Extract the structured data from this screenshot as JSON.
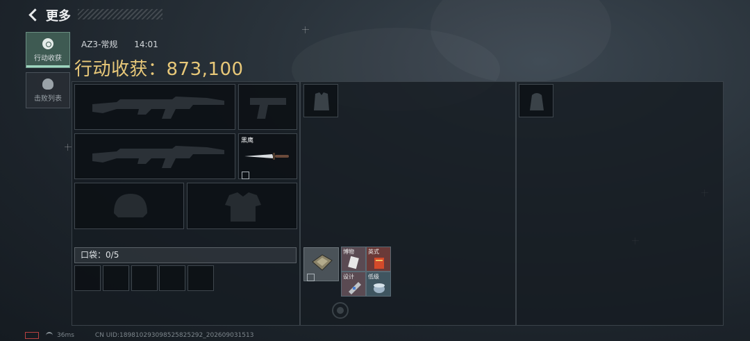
{
  "header": {
    "title": "更多"
  },
  "sidebar": {
    "tabs": [
      {
        "label": "行动收获",
        "active": true,
        "icon": "loot-icon"
      },
      {
        "label": "击败列表",
        "active": false,
        "icon": "skull-icon"
      }
    ]
  },
  "match": {
    "map_mode": "AZ3-常规",
    "time": "14:01"
  },
  "haul": {
    "label": "行动收获：",
    "value": "873,100",
    "color": "#e8c879"
  },
  "loadout": {
    "knife_label": "黑鹰",
    "pocket_label": "口袋：",
    "pocket_count": "0",
    "pocket_capacity": "/5",
    "pocket_slots": 5
  },
  "container_items": [
    {
      "label": "博物",
      "icon": "document-icon",
      "bg": "#5a4a52"
    },
    {
      "label": "英式",
      "icon": "book-icon",
      "bg": "#6a3a38"
    },
    {
      "label": "设计",
      "icon": "blueprint-icon",
      "bg": "#5a4a52"
    },
    {
      "label": "低级",
      "icon": "jar-icon",
      "bg": "#3f5560"
    }
  ],
  "footer": {
    "ping": "36ms",
    "uid": "CN UID:189810293098525825292_202609031513"
  }
}
